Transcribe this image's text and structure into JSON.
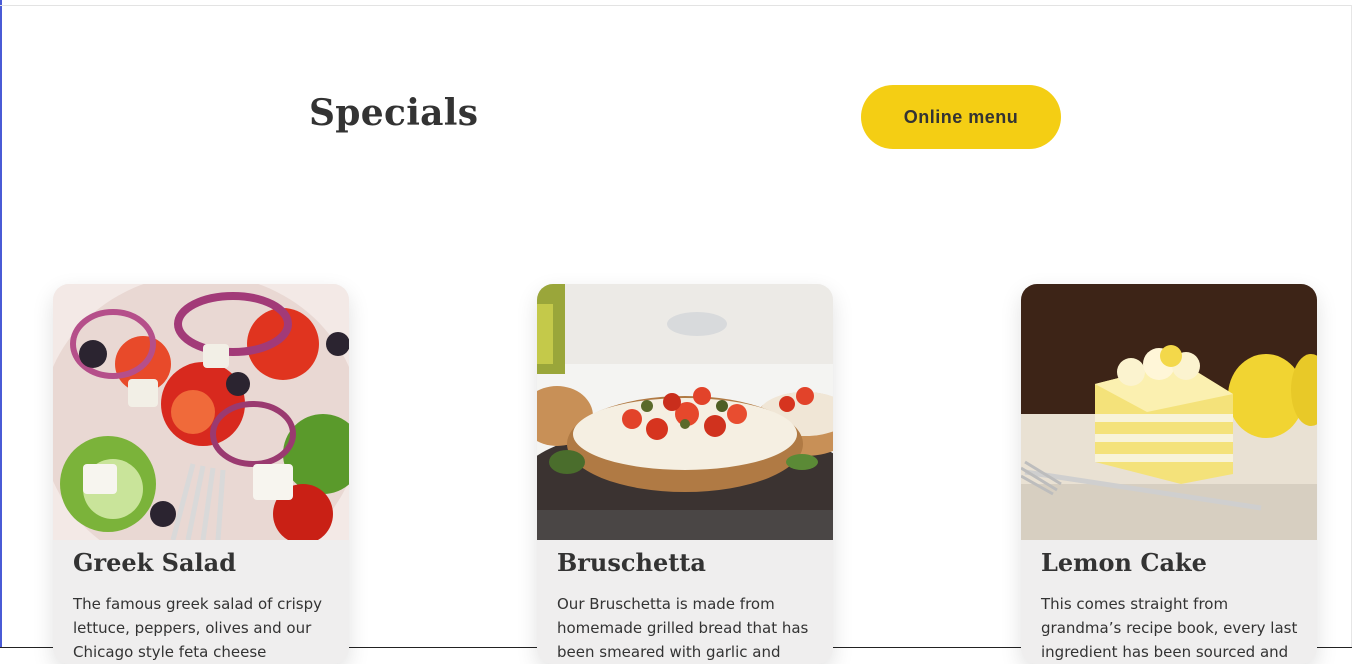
{
  "specials": {
    "heading": "Specials",
    "menu_button": "Online menu"
  },
  "cards": [
    {
      "title": "Greek Salad",
      "description": "The famous greek salad of crispy lettuce, peppers, olives and our Chicago style feta cheese",
      "image": "greek-salad-photo"
    },
    {
      "title": "Bruschetta",
      "description": "Our Bruschetta is made from homemade grilled bread that has been smeared with garlic and seasoned",
      "image": "bruschetta-photo"
    },
    {
      "title": "Lemon Cake",
      "description": "This comes straight from grandma’s recipe book, every last ingredient has been sourced and is",
      "image": "lemon-cake-photo"
    }
  ],
  "colors": {
    "accent": "#f4ce14",
    "text": "#333333",
    "card_bg": "#efeeee"
  }
}
